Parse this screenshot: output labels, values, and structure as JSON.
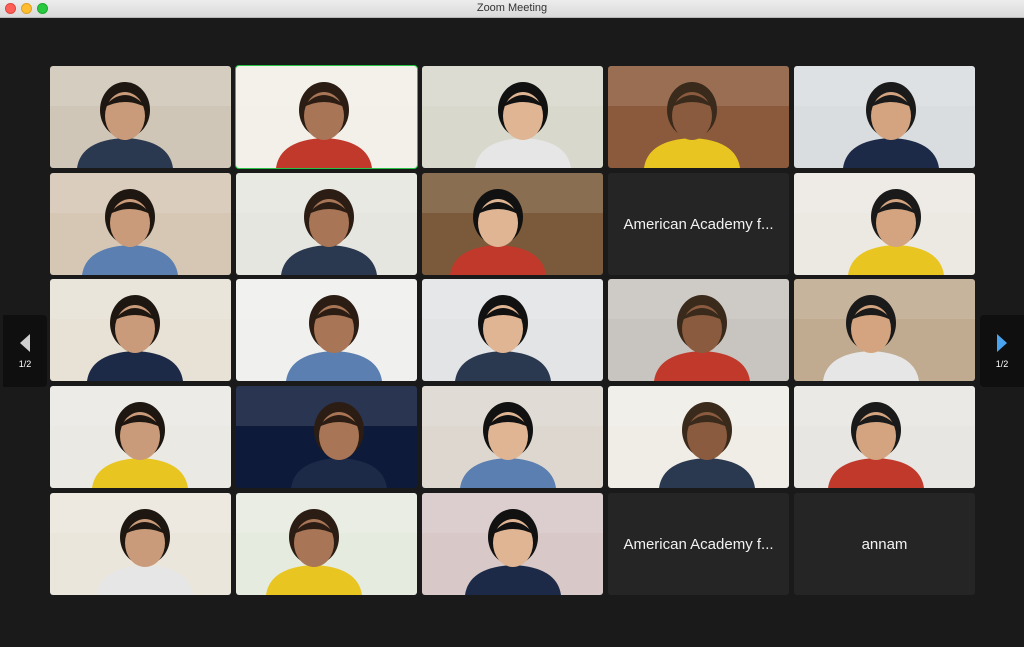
{
  "window": {
    "title": "Zoom Meeting"
  },
  "pagination": {
    "left_label": "1/2",
    "right_label": "1/2"
  },
  "tiles": [
    {
      "type": "video",
      "bg": "#cfc6b8"
    },
    {
      "type": "video",
      "bg": "#f3efe9",
      "active": true
    },
    {
      "type": "video",
      "bg": "#d8d8cc"
    },
    {
      "type": "video",
      "bg": "#8b5a3c"
    },
    {
      "type": "video",
      "bg": "#d9dde0"
    },
    {
      "type": "video",
      "bg": "#d6c7b5"
    },
    {
      "type": "video",
      "bg": "#e6e6e0"
    },
    {
      "type": "video",
      "bg": "#7a5a3a"
    },
    {
      "type": "name",
      "name": "American Academy f..."
    },
    {
      "type": "video",
      "bg": "#ece8e2"
    },
    {
      "type": "video",
      "bg": "#e8e2d6"
    },
    {
      "type": "video",
      "bg": "#f0f0ee"
    },
    {
      "type": "video",
      "bg": "#e2e4e6"
    },
    {
      "type": "video",
      "bg": "#c8c4c0"
    },
    {
      "type": "video",
      "bg": "#c0aa90"
    },
    {
      "type": "video",
      "bg": "#ebe9e4"
    },
    {
      "type": "video",
      "bg": "#0d1a3a"
    },
    {
      "type": "video",
      "bg": "#ddd7d0"
    },
    {
      "type": "video",
      "bg": "#f0ede6"
    },
    {
      "type": "video",
      "bg": "#e8e6e2"
    },
    {
      "type": "video",
      "bg": "#ebe6dc"
    },
    {
      "type": "video",
      "bg": "#e6ebe0"
    },
    {
      "type": "video",
      "bg": "#d8c8c8"
    },
    {
      "type": "name",
      "name": "American Academy f..."
    },
    {
      "type": "name",
      "name": "annam"
    }
  ]
}
